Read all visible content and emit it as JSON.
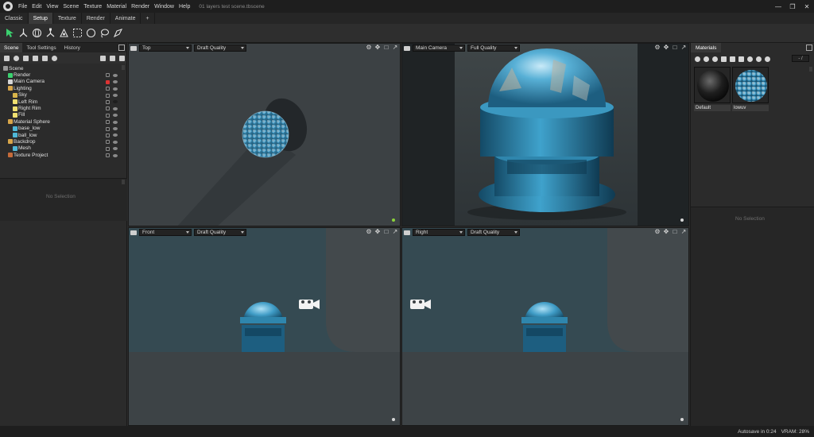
{
  "menubar": {
    "items": [
      "File",
      "Edit",
      "View",
      "Scene",
      "Texture",
      "Material",
      "Render",
      "Window",
      "Help"
    ],
    "doc_title": "01 layers test scene.tbscene"
  },
  "tabs": {
    "items": [
      {
        "label": "Classic",
        "active": false
      },
      {
        "label": "Setup",
        "active": true
      },
      {
        "label": "Texture",
        "active": false
      },
      {
        "label": "Render",
        "active": false
      },
      {
        "label": "Animate",
        "active": false
      }
    ],
    "add_label": "+"
  },
  "toolbar": {
    "tools": [
      "select-arrow-icon",
      "transform-icon",
      "rotate-icon",
      "scale-icon",
      "pivot-icon",
      "rect-select-icon",
      "circle-select-icon",
      "lasso-icon",
      "paint-select-icon"
    ],
    "accent": "#3bd16f"
  },
  "left_panel": {
    "tabs": [
      {
        "label": "Scene",
        "active": true
      },
      {
        "label": "Tool Settings",
        "active": false
      },
      {
        "label": "History",
        "active": false
      }
    ],
    "tree": [
      {
        "label": "Scene",
        "depth": 0,
        "icon": "#9a9a9a",
        "lock": "",
        "eye": ""
      },
      {
        "label": "Render",
        "depth": 1,
        "icon": "#3bd16f",
        "lock": "normal",
        "eye": "normal"
      },
      {
        "label": "Main Camera",
        "depth": 1,
        "icon": "#d6d6d6",
        "lock": "red",
        "eye": "normal"
      },
      {
        "label": "Lighting",
        "depth": 1,
        "icon": "#d8a64a",
        "lock": "normal",
        "eye": "normal"
      },
      {
        "label": "Sky",
        "depth": 2,
        "icon": "#d8b44a",
        "lock": "normal",
        "eye": "normal"
      },
      {
        "label": "Left Rim",
        "depth": 2,
        "icon": "#f0e070",
        "lock": "normal",
        "eye": "dark"
      },
      {
        "label": "Right Rim",
        "depth": 2,
        "icon": "#f0e070",
        "lock": "normal",
        "eye": "normal"
      },
      {
        "label": "Fill",
        "depth": 2,
        "icon": "#f0e070",
        "lock": "normal",
        "eye": "normal"
      },
      {
        "label": "Material Sphere",
        "depth": 1,
        "icon": "#d8a64a",
        "lock": "normal",
        "eye": "normal"
      },
      {
        "label": "base_low",
        "depth": 2,
        "icon": "#4fb8d8",
        "lock": "normal",
        "eye": "normal"
      },
      {
        "label": "ball_low",
        "depth": 2,
        "icon": "#4fb8d8",
        "lock": "normal",
        "eye": "normal"
      },
      {
        "label": "Backdrop",
        "depth": 1,
        "icon": "#d8a64a",
        "lock": "normal",
        "eye": "normal"
      },
      {
        "label": "Mesh",
        "depth": 2,
        "icon": "#4fb8d8",
        "lock": "normal",
        "eye": "normal"
      },
      {
        "label": "Texture Project",
        "depth": 1,
        "icon": "#c46b3a",
        "lock": "normal",
        "eye": "normal"
      }
    ],
    "no_selection": "No Selection"
  },
  "viewports": [
    {
      "id": "top",
      "camera": "Top",
      "quality": "Draft Quality",
      "dot": "#8bd13b"
    },
    {
      "id": "main",
      "camera": "Main Camera",
      "quality": "Full Quality",
      "dot": "#d6d6d6"
    },
    {
      "id": "front",
      "camera": "Front",
      "quality": "Draft Quality",
      "dot": "#d6d6d6"
    },
    {
      "id": "right",
      "camera": "Right",
      "quality": "Draft Quality",
      "dot": "#d6d6d6"
    }
  ],
  "materials_panel": {
    "tab_label": "Materials",
    "selector": "- / ",
    "materials": [
      {
        "label": "Default"
      },
      {
        "label": "lowuv"
      }
    ],
    "no_selection": "No Selection"
  },
  "statusbar": {
    "autosave": "Autosave in 0:24",
    "vram": "VRAM: 28%"
  }
}
